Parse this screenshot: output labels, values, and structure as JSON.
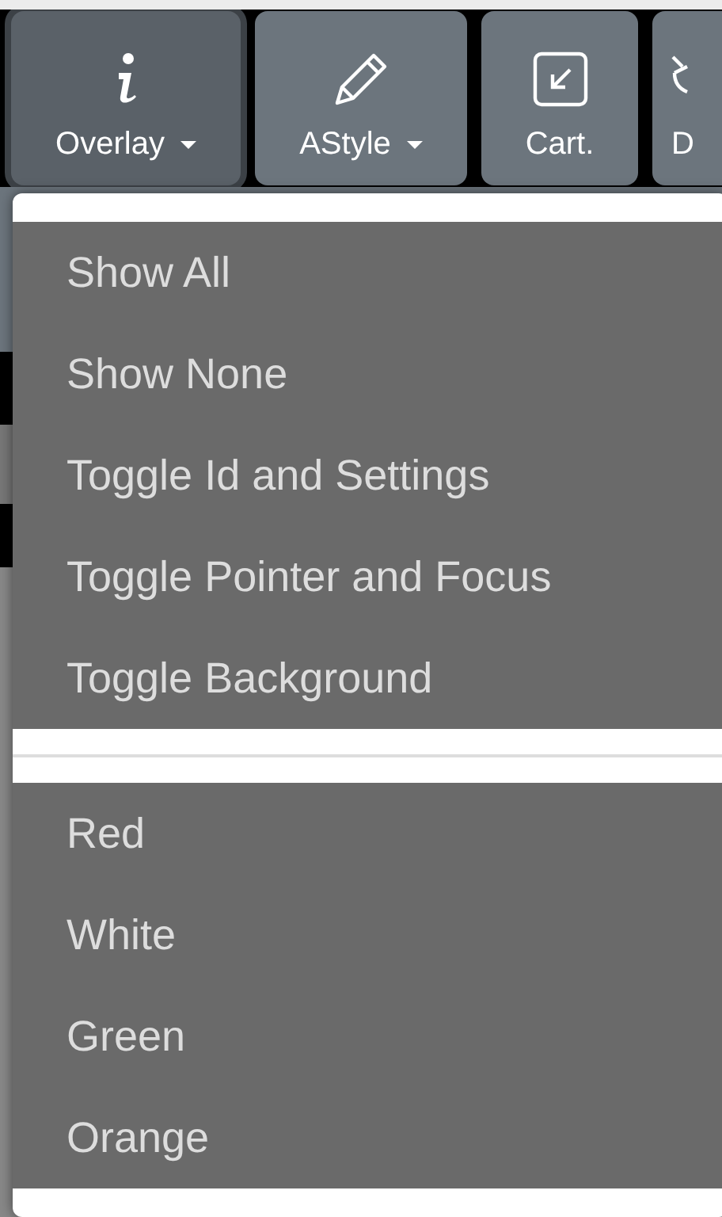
{
  "toolbar": {
    "buttons": [
      {
        "kind": "info",
        "label": "Overlay",
        "dropdown": true,
        "selected": true
      },
      {
        "kind": "pencil",
        "label": "AStyle",
        "dropdown": true,
        "selected": false
      },
      {
        "kind": "corner",
        "label": "Cart.",
        "dropdown": false,
        "selected": false
      },
      {
        "kind": "partial",
        "label": "D",
        "dropdown": false,
        "selected": false
      }
    ]
  },
  "menu": {
    "groups": [
      {
        "items": [
          "Show All",
          "Show None",
          "Toggle Id and Settings",
          "Toggle Pointer and Focus",
          "Toggle Background"
        ]
      },
      {
        "items": [
          "Red",
          "White",
          "Green",
          "Orange"
        ]
      }
    ]
  }
}
